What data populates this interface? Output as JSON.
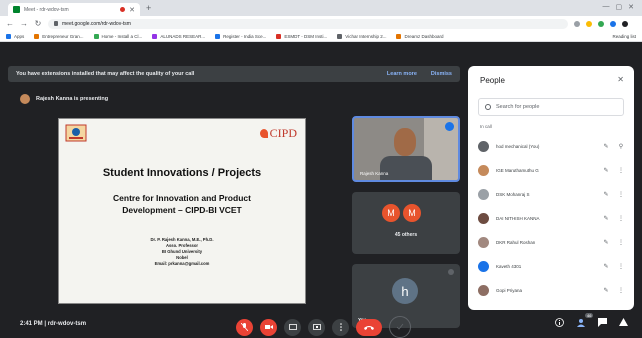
{
  "browser": {
    "tab_title": "Meet - rdr-wdov-tsm",
    "url": "meet.google.com/rdr-wdov-tsm",
    "bookmarks": [
      "Apps",
      "Entrepreneur Gran...",
      "Home - Install a Cl...",
      "ALUNADS RESEAR...",
      "Register - India Sce...",
      "ESMDT - DSM Insti...",
      "Vichar Internship 2...",
      "Dreamz Dashboard"
    ],
    "bookmark_colors": [
      "#1a73e8",
      "#e37400",
      "#34a853",
      "#9334e6",
      "#1a73e8",
      "#d93025",
      "#5f6368",
      "#e37400"
    ],
    "reading_list": "Reading list"
  },
  "banner": {
    "text": "You have extensions installed that may affect the quality of your call",
    "learn_more": "Learn more",
    "dismiss": "Dismiss"
  },
  "presenting": {
    "text": "Rajesh Kanna is presenting"
  },
  "slide": {
    "logo_right": "CIPD",
    "title": "Student Innovations / Projects",
    "subtitle_line1": "Centre for Innovation and Product",
    "subtitle_line2": "Development – CIPD-BI VCET",
    "info": [
      "Dr. P. Rajesh Kanna, M.E., Ph.D.",
      "Asso. Professor",
      "BI Ghund University",
      "Nobel",
      "Email: prkanna@gmail.com"
    ]
  },
  "tiles": {
    "camera_name": "Rajesh Kanna",
    "others_avatars": [
      "M",
      "M"
    ],
    "others_label": "45 others",
    "you_avatar": "h",
    "you_label": "You"
  },
  "bottom": {
    "time": "2:41 PM",
    "separator": "|",
    "meeting_code": "rdr-wdov-tsm",
    "participant_badge": "46"
  },
  "people": {
    "title": "People",
    "search_placeholder": "Search for people",
    "section_label": "In call",
    "participants": [
      {
        "name": "hod mechanical (You)",
        "color": "#5f6368"
      },
      {
        "name": "IGE Maruthamuthu G",
        "color": "#c58a5b"
      },
      {
        "name": "DSK Mohanraj S",
        "color": "#9aa0a6"
      },
      {
        "name": "DAI NITHISH KANNA",
        "color": "#6d4c41"
      },
      {
        "name": "DKR Rahul Roshan",
        "color": "#a1887f"
      },
      {
        "name": "Kaveth 4301",
        "color": "#1a73e8"
      },
      {
        "name": "Gopi Priyana",
        "color": "#8d6e63"
      }
    ]
  }
}
